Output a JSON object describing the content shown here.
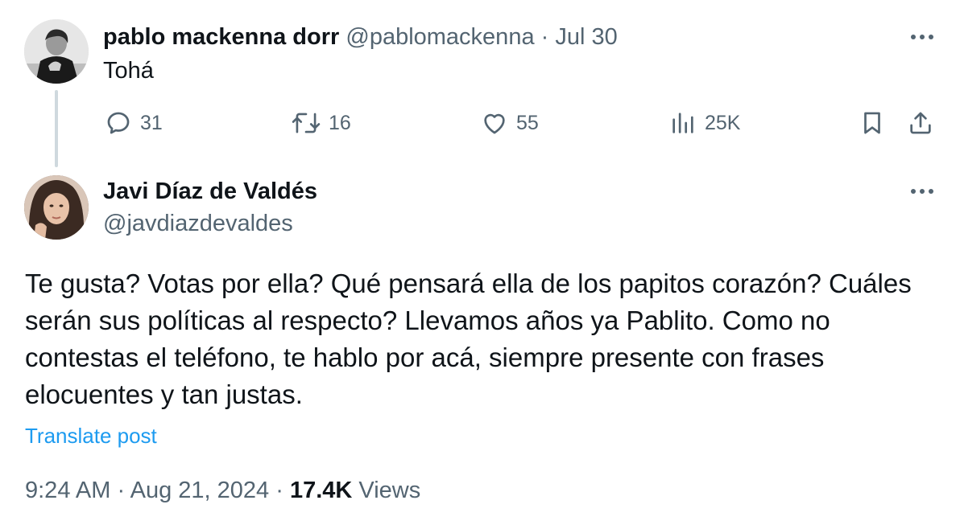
{
  "parent_tweet": {
    "author_name": "pablo mackenna dorr",
    "author_handle": "@pablomackenna",
    "separator": "·",
    "date": "Jul 30",
    "text": "Tohá",
    "actions": {
      "replies": "31",
      "reposts": "16",
      "likes": "55",
      "views": "25K"
    }
  },
  "reply_tweet": {
    "author_name": "Javi Díaz de Valdés",
    "author_handle": "@javdiazdevaldes",
    "text": "Te gusta? Votas por ella? Qué pensará ella de los papitos corazón? Cuáles serán sus políticas al respecto? Llevamos años ya Pablito. Como no contestas el teléfono, te hablo por acá, siempre presente con frases elocuentes y tan justas.",
    "translate_label": "Translate post",
    "time": "9:24 AM",
    "separator": "·",
    "date": "Aug 21, 2024",
    "views_count": "17.4K",
    "views_label": "Views"
  },
  "icons": {
    "reply": "reply-icon",
    "repost": "repost-icon",
    "like": "heart-icon",
    "views": "analytics-icon",
    "bookmark": "bookmark-icon",
    "share": "share-icon",
    "more": "more-icon"
  },
  "colors": {
    "text": "#0f1419",
    "muted": "#536471",
    "link": "#1d9bf0",
    "thread_line": "#cfd9de"
  }
}
